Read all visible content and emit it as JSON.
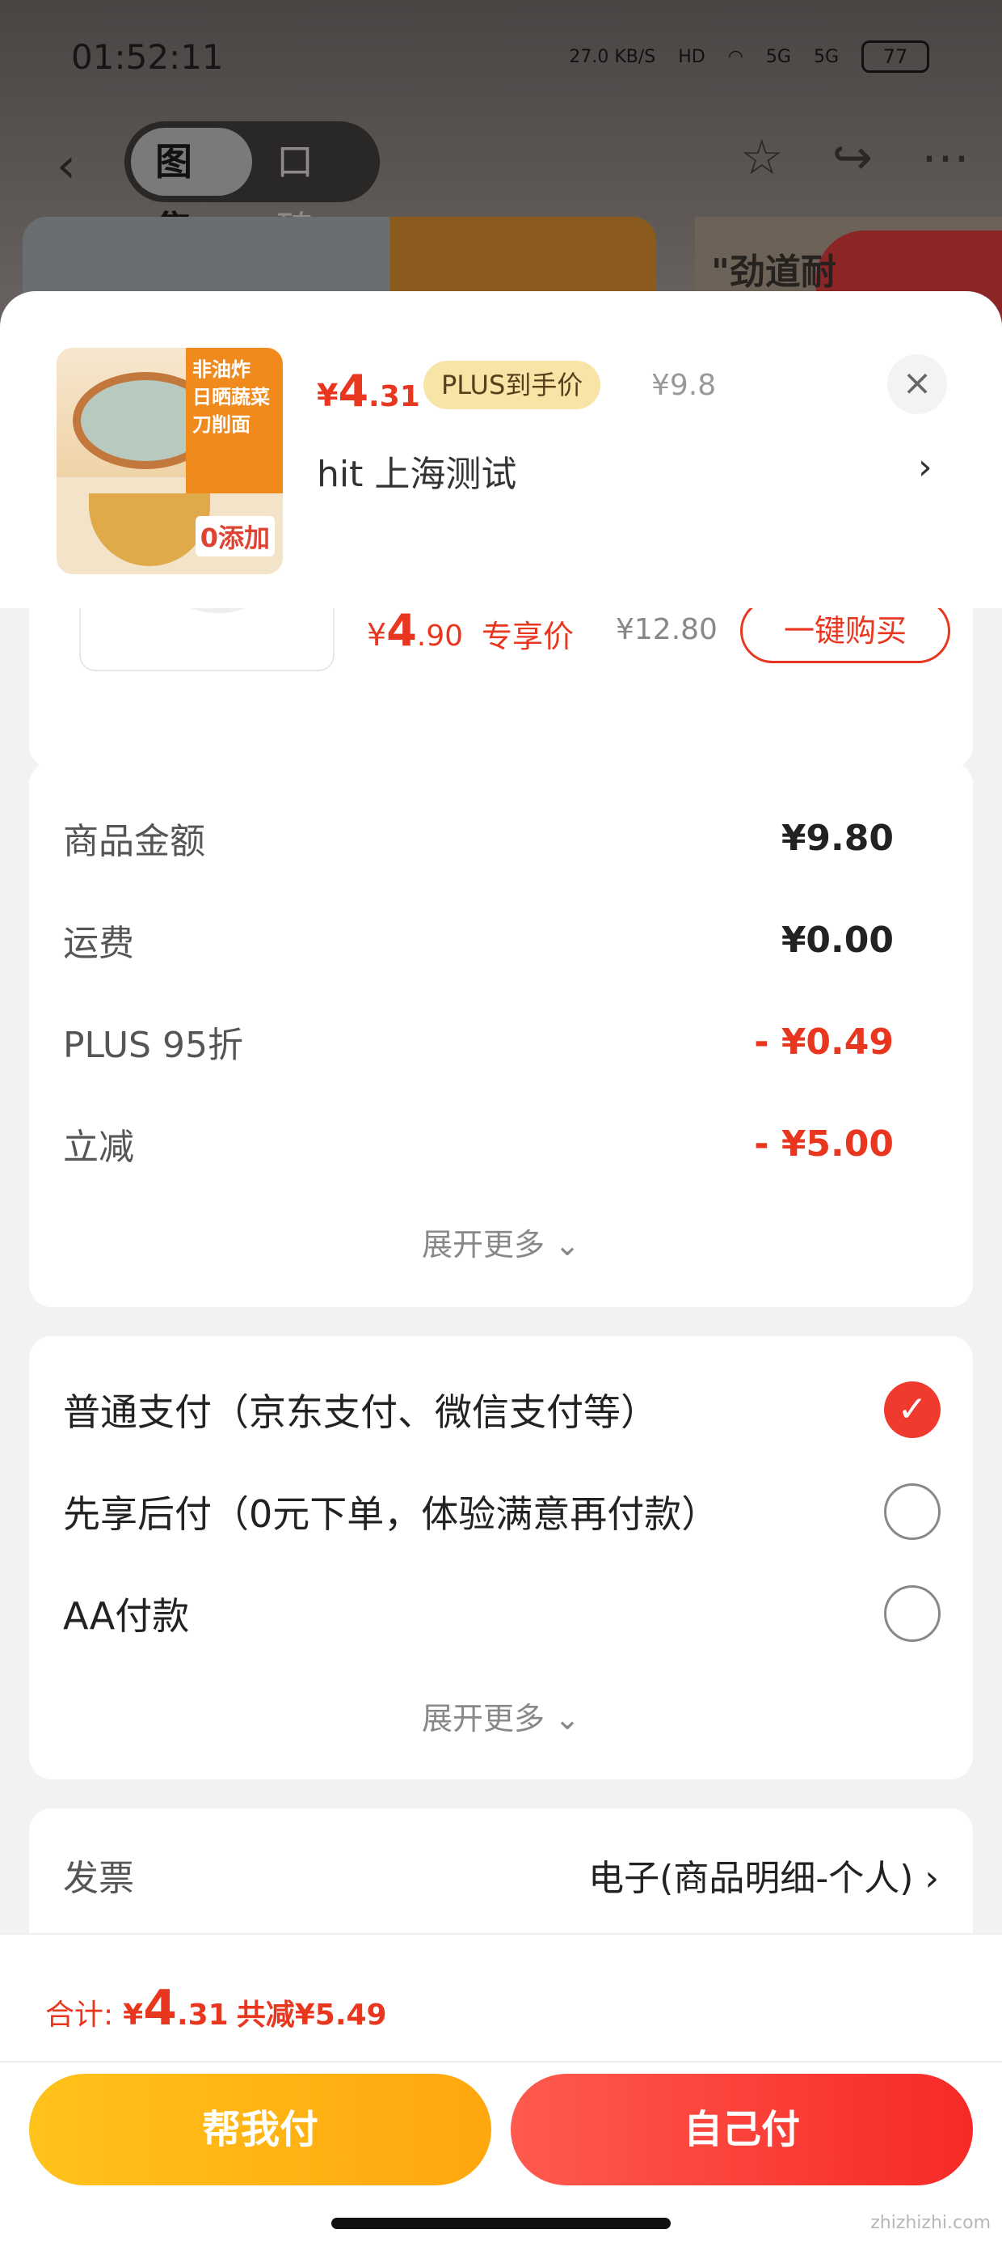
{
  "status_bar": {
    "time": "01:52:11",
    "net_speed": "27.0 KB/S",
    "hd": "HD",
    "signal1": "5G",
    "signal2": "5G",
    "battery": "77"
  },
  "background_nav": {
    "tabs": [
      {
        "label": "图集",
        "active": true
      },
      {
        "label": "口碑",
        "active": false
      }
    ],
    "banner_text": "\"劲道耐"
  },
  "product_header": {
    "price_symbol": "¥",
    "price_int": "4",
    "price_dec": ".31",
    "plus_tag": "PLUS到手价",
    "original_price": "¥9.8",
    "name": "hit  上海测试",
    "thumb_label": "非油炸 日晒蔬菜 刀削面",
    "thumb_badge": "0添加"
  },
  "recommend_card": {
    "price_symbol": "¥",
    "price_int": "4",
    "price_dec": ".90",
    "tag": "专享价",
    "original_price": "¥12.80",
    "buy_label": "一键购买"
  },
  "price_breakdown": {
    "rows": [
      {
        "label": "商品金额",
        "value": "¥9.80"
      },
      {
        "label": "运费",
        "value": "¥0.00"
      },
      {
        "label": "PLUS 95折",
        "value": "- ¥0.49"
      },
      {
        "label": "立减",
        "value": "- ¥5.00"
      }
    ],
    "expand_label": "展开更多 ⌄"
  },
  "payment": {
    "options": [
      {
        "label": "普通支付（京东支付、微信支付等）",
        "checked": true
      },
      {
        "label": "先享后付（0元下单，体验满意再付款）",
        "checked": false
      },
      {
        "label": "AA付款",
        "checked": false
      }
    ],
    "expand_label": "展开更多 ⌄"
  },
  "invoice": {
    "label": "发票",
    "value": "电子(商品明细-个人)"
  },
  "bottom": {
    "total_label": "合计:",
    "total_symbol": "¥",
    "total_int": "4",
    "total_dec": ".31",
    "discount": "共减¥5.49",
    "help_pay": "帮我付",
    "self_pay": "自己付",
    "watermark": "zhizhizhi.com"
  },
  "colors": {
    "accent_red": "#e8361f",
    "help_button": "#ffb514",
    "self_button": "#f43a2f"
  }
}
